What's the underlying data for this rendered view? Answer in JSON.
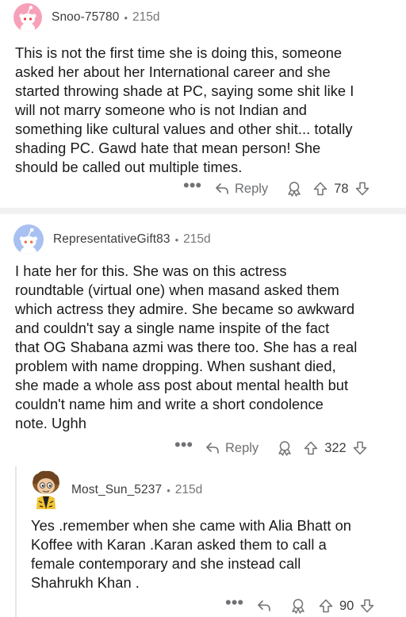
{
  "comments": [
    {
      "author": "Snoo-75780",
      "age": "215d",
      "body": "This is not the first time she is doing this, someone\nasked her about her International career and she\nstarted throwing shade at PC, saying some shit like I\nwill not marry someone who is not Indian and\nsomething like cultural values and other shit... totally\nshading PC. Gawd hate that mean person! She\nshould be called out multiple times.",
      "more": "•••",
      "reply_label": "Reply",
      "score": "78",
      "avatar_color": "#f7a1b8"
    },
    {
      "author": "RepresentativeGift83",
      "age": "215d",
      "body": "I hate her for this. She was on this actress\nroundtable (virtual one) when masand asked them\nwhich actress they admire. She became so awkward\nand couldn't say a single name inspite of the fact\nthat OG Shabana azmi was there too. She has a real\nproblem with name dropping. When sushant died,\nshe made a whole ass post about mental health but\ncouldn't name him and write a short condolence\nnote. Ughh",
      "more": "•••",
      "reply_label": "Reply",
      "score": "322",
      "avatar_color": "#a8c0f2"
    },
    {
      "author": "Most_Sun_5237",
      "age": "215d",
      "body": "Yes .remember when she came with Alia Bhatt  on\nKoffee with  Karan .Karan asked them to call a\nfemale contemporary and she instead  call\nShahrukh  Khan .",
      "more": "•••",
      "score": "90"
    }
  ],
  "dot": "•"
}
